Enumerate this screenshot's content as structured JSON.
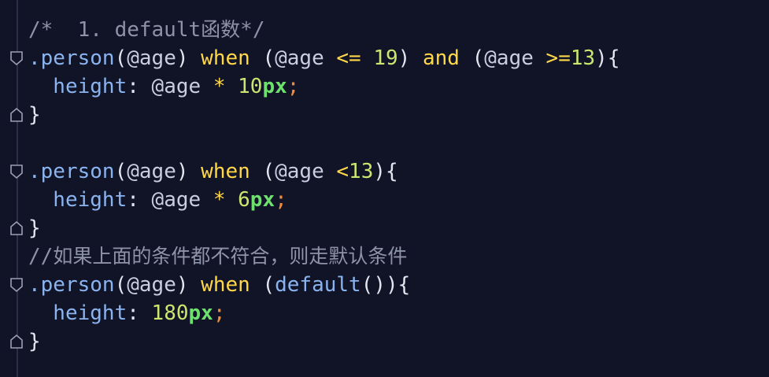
{
  "lines": [
    {
      "parts": [
        [
          "c-comment",
          "/*  1. default"
        ],
        [
          "c-zh",
          "函数"
        ],
        [
          "c-comment",
          "*/"
        ]
      ]
    },
    {
      "parts": [
        [
          "c-sel",
          ".person"
        ],
        [
          "c-punc",
          "("
        ],
        [
          "c-var",
          "@age"
        ],
        [
          "c-punc",
          ") "
        ],
        [
          "c-kw",
          "when"
        ],
        [
          "c-punc",
          " ("
        ],
        [
          "c-var",
          "@age "
        ],
        [
          "c-op",
          "<="
        ],
        [
          "c-num",
          " 19"
        ],
        [
          "c-punc",
          ") "
        ],
        [
          "c-kw",
          "and"
        ],
        [
          "c-punc",
          " ("
        ],
        [
          "c-var",
          "@age "
        ],
        [
          "c-op",
          ">="
        ],
        [
          "c-num",
          "13"
        ],
        [
          "c-punc",
          "){"
        ]
      ]
    },
    {
      "parts": [
        [
          "c-prop",
          "  height"
        ],
        [
          "c-punc",
          ": "
        ],
        [
          "c-var",
          "@age "
        ],
        [
          "c-op",
          "*"
        ],
        [
          "c-num",
          " 10"
        ],
        [
          "c-unit",
          "px"
        ],
        [
          "c-semi",
          ";"
        ]
      ]
    },
    {
      "parts": [
        [
          "c-punc",
          "}"
        ]
      ]
    },
    {
      "parts": [
        [
          "c-punc",
          ""
        ]
      ]
    },
    {
      "parts": [
        [
          "c-sel",
          ".person"
        ],
        [
          "c-punc",
          "("
        ],
        [
          "c-var",
          "@age"
        ],
        [
          "c-punc",
          ") "
        ],
        [
          "c-kw",
          "when"
        ],
        [
          "c-punc",
          " ("
        ],
        [
          "c-var",
          "@age "
        ],
        [
          "c-op",
          "<"
        ],
        [
          "c-num",
          "13"
        ],
        [
          "c-punc",
          "){"
        ]
      ]
    },
    {
      "parts": [
        [
          "c-prop",
          "  height"
        ],
        [
          "c-punc",
          ": "
        ],
        [
          "c-var",
          "@age "
        ],
        [
          "c-op",
          "*"
        ],
        [
          "c-num",
          " 6"
        ],
        [
          "c-unit",
          "px"
        ],
        [
          "c-semi",
          ";"
        ]
      ]
    },
    {
      "parts": [
        [
          "c-punc",
          "}"
        ]
      ]
    },
    {
      "parts": [
        [
          "c-comment",
          "//"
        ],
        [
          "c-zh",
          "如果上面的条件都不符合，则走默认条件"
        ]
      ]
    },
    {
      "parts": [
        [
          "c-sel",
          ".person"
        ],
        [
          "c-punc",
          "("
        ],
        [
          "c-var",
          "@age"
        ],
        [
          "c-punc",
          ") "
        ],
        [
          "c-kw",
          "when"
        ],
        [
          "c-punc",
          " ("
        ],
        [
          "c-fn",
          "default"
        ],
        [
          "c-punc",
          "()){"
        ]
      ]
    },
    {
      "parts": [
        [
          "c-prop",
          "  height"
        ],
        [
          "c-punc",
          ": "
        ],
        [
          "c-num",
          "180"
        ],
        [
          "c-unit",
          "px"
        ],
        [
          "c-semi",
          ";"
        ]
      ]
    },
    {
      "parts": [
        [
          "c-punc",
          "}"
        ]
      ]
    }
  ],
  "fold_markers": {
    "1": "fold-open-icon",
    "3": "fold-close-icon",
    "5": "fold-open-icon",
    "7": "fold-close-icon",
    "9": "fold-open-icon",
    "11": "fold-close-icon"
  }
}
